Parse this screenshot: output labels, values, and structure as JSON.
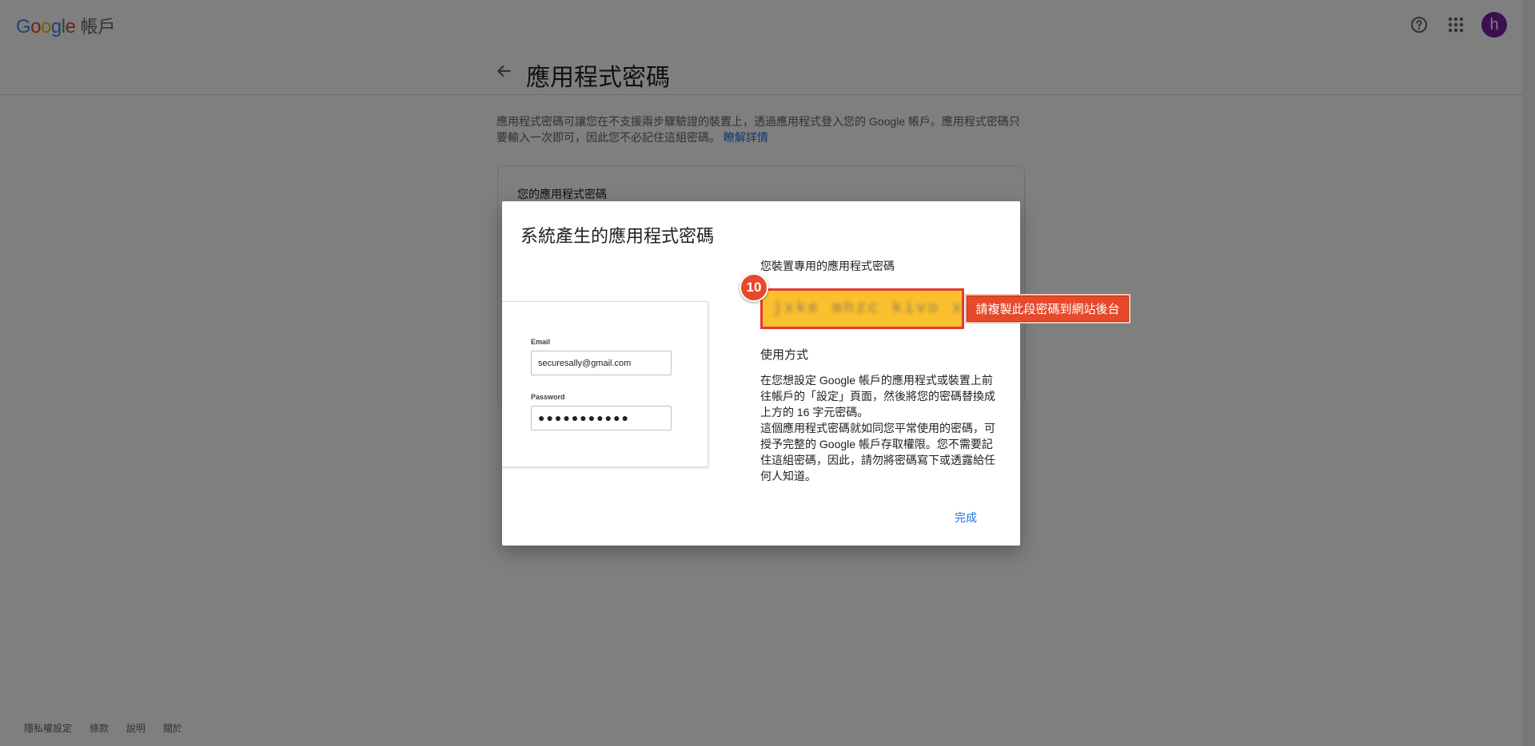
{
  "header": {
    "logo_word": "Google",
    "product_name": "帳戶",
    "avatar_letter": "h",
    "icons": {
      "help": "help-circle-icon",
      "apps": "apps-grid-icon"
    }
  },
  "page": {
    "title": "應用程式密碼",
    "intro_text": "應用程式密碼可讓您在不支援兩步驟驗證的裝置上，透過應用程式登入您的 Google 帳戶。應用程式密碼只要輸入一次即可，因此您不必記住這組密碼。",
    "learn_more": "瞭解詳情",
    "card_title": "您的應用程式密碼"
  },
  "dialog": {
    "title": "系統產生的應用程式密碼",
    "illustration": {
      "email_label": "Email",
      "email_value": "securesally@gmail.com",
      "password_label": "Password",
      "password_value": "●●●●●●●●●●●"
    },
    "password_label": "您裝置專用的應用程式密碼",
    "password_value": "jxke mhzc kivo xicv",
    "usage_title": "使用方式",
    "usage_para1": "在您想設定 Google 帳戶的應用程式或裝置上前往帳戶的「設定」頁面，然後將您的密碼替換成上方的 16 字元密碼。",
    "usage_para2": "這個應用程式密碼就如同您平常使用的密碼，可授予完整的 Google 帳戶存取權限。您不需要記住這組密碼，因此，請勿將密碼寫下或透露給任何人知道。",
    "done_label": "完成"
  },
  "annotation": {
    "step_number": "10",
    "callout_text": "請複製此段密碼到網站後台",
    "colors": {
      "badge": "#e64a2a",
      "highlight_fill": "#fbc02d",
      "highlight_border": "#e53935"
    }
  },
  "footer": {
    "links": [
      "隱私權設定",
      "條款",
      "說明",
      "關於"
    ]
  }
}
